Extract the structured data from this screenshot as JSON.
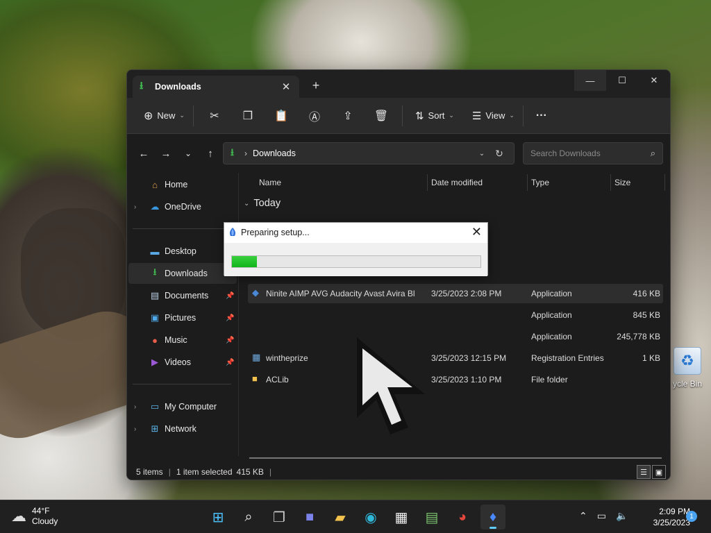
{
  "desktop": {
    "recycle_bin_label": "ycle Bin"
  },
  "explorer": {
    "tab_title": "Downloads",
    "toolbar": {
      "new_label": "New",
      "sort_label": "Sort",
      "view_label": "View",
      "more_label": "···"
    },
    "address": {
      "path": "Downloads",
      "search_placeholder": "Search Downloads"
    },
    "sidebar": {
      "items": [
        {
          "label": "Home",
          "icon": "home-icon"
        },
        {
          "label": "OneDrive",
          "icon": "cloud-icon"
        },
        {
          "label": "Desktop",
          "icon": "desktop-icon"
        },
        {
          "label": "Downloads",
          "icon": "download-icon"
        },
        {
          "label": "Documents",
          "icon": "document-icon"
        },
        {
          "label": "Pictures",
          "icon": "pictures-icon"
        },
        {
          "label": "Music",
          "icon": "music-icon"
        },
        {
          "label": "Videos",
          "icon": "videos-icon"
        },
        {
          "label": "My Computer",
          "icon": "computer-icon"
        },
        {
          "label": "Network",
          "icon": "network-icon"
        }
      ]
    },
    "columns": {
      "name": "Name",
      "date": "Date modified",
      "type": "Type",
      "size": "Size"
    },
    "group_label": "Today",
    "files": [
      {
        "name": "Ninite AIMP AVG Audacity Avast Avira Bl",
        "date": "3/25/2023 2:08 PM",
        "type": "Application",
        "size": "416 KB"
      },
      {
        "name": "",
        "date": "",
        "type": "Application",
        "size": "845 KB"
      },
      {
        "name": "",
        "date": "",
        "type": "Application",
        "size": "245,778 KB"
      },
      {
        "name": "wintheprize",
        "date": "3/25/2023 12:15 PM",
        "type": "Registration Entries",
        "size": "1 KB"
      },
      {
        "name": "ACLib",
        "date": "3/25/2023 1:10 PM",
        "type": "File folder",
        "size": ""
      }
    ],
    "status": {
      "item_count": "5 items",
      "selection": "1 item selected",
      "selection_size": "415 KB"
    }
  },
  "dialog": {
    "title": "Preparing setup...",
    "close_glyph": "✕",
    "progress": 0.1,
    "progress_color": "#1fc425"
  },
  "taskbar": {
    "weather_temp": "44°F",
    "weather_condition": "Cloudy",
    "time": "2:09 PM",
    "date": "3/25/2023",
    "notification_count": "1"
  }
}
